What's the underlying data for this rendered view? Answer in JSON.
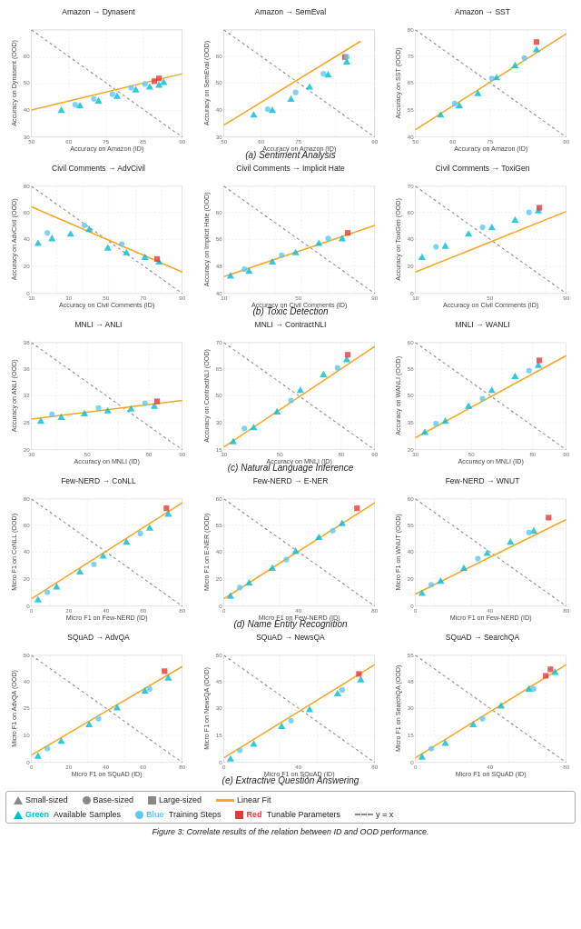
{
  "charts": {
    "row1": {
      "label": "(a) Sentiment Analysis",
      "plots": [
        {
          "title": "Amazon → Dynasent",
          "xLabel": "Accuracy on Amazon (ID)",
          "yLabel": "Accuracy on Dynasent (OOD)",
          "xRange": [
            50,
            90
          ],
          "yRange": [
            30,
            60
          ]
        },
        {
          "title": "Amazon → SemEval",
          "xLabel": "Accuracy on Amazon (ID)",
          "yLabel": "Accuracy on SemEval (OOD)",
          "xRange": [
            50,
            90
          ],
          "yRange": [
            30,
            60
          ]
        },
        {
          "title": "Amazon → SST",
          "xLabel": "Accuracy on Amazon (ID)",
          "yLabel": "Accuracy on SST (OOD)",
          "xRange": [
            50,
            90
          ],
          "yRange": [
            40,
            80
          ]
        }
      ]
    },
    "row2": {
      "label": "(b) Toxic Detection",
      "plots": [
        {
          "title": "Civil Comments → AdvCivil",
          "xLabel": "Accuracy on Civil Comments (ID)",
          "yLabel": "Accuracy on AdvCivil (OOD)",
          "xRange": [
            10,
            90
          ],
          "yRange": [
            0,
            80
          ]
        },
        {
          "title": "Civil Comments → Implicit Hate",
          "xLabel": "Accuracy on Civil Comments (ID)",
          "yLabel": "Accuracy on Implicit Hate (OOD)",
          "xRange": [
            10,
            90
          ],
          "yRange": [
            40,
            60
          ]
        },
        {
          "title": "Civil Comments → ToxiGen",
          "xLabel": "Accuracy on Civil Comments (ID)",
          "yLabel": "Accuracy on ToxiGen (OOD)",
          "xRange": [
            10,
            90
          ],
          "yRange": [
            0,
            70
          ]
        }
      ]
    },
    "row3": {
      "label": "(c) Natural Language Inference",
      "plots": [
        {
          "title": "MNLI → ANLI",
          "xLabel": "Accuracy on MNLI (ID)",
          "yLabel": "Accuracy on ANLI (OOD)",
          "xRange": [
            30,
            90
          ],
          "yRange": [
            20,
            38
          ]
        },
        {
          "title": "MNLI → ContractNLI",
          "xLabel": "Accuracy on MNLI (ID)",
          "yLabel": "Accuracy on ContractNLI (OOD)",
          "xRange": [
            30,
            90
          ],
          "yRange": [
            15,
            70
          ]
        },
        {
          "title": "MNLI → WANLI",
          "xLabel": "Accuracy on MNLI (ID)",
          "yLabel": "Accuracy on WANLI (OOD)",
          "xRange": [
            30,
            90
          ],
          "yRange": [
            20,
            60
          ]
        }
      ]
    },
    "row4": {
      "label": "(d) Name Entity Recognition",
      "plots": [
        {
          "title": "Few-NERD → CoNLL",
          "xLabel": "Micro F1 on Few-NERD (ID)",
          "yLabel": "Micro F1 on CoNLL (OOD)",
          "xRange": [
            0,
            80
          ],
          "yRange": [
            0,
            80
          ]
        },
        {
          "title": "Few-NERD → E-NER",
          "xLabel": "Micro F1 on Few-NERD (ID)",
          "yLabel": "Micro F1 on E-NER (OOD)",
          "xRange": [
            0,
            80
          ],
          "yRange": [
            0,
            60
          ]
        },
        {
          "title": "Few-NERD → WNUT",
          "xLabel": "Micro F1 on Few-NERD (ID)",
          "yLabel": "Micro F1 on WNUT (OOD)",
          "xRange": [
            0,
            80
          ],
          "yRange": [
            0,
            60
          ]
        }
      ]
    },
    "row5": {
      "label": "(e) Extractive Question Answering",
      "plots": [
        {
          "title": "SQuAD → AdvQA",
          "xLabel": "Micro F1 on SQuAD (ID)",
          "yLabel": "Micro F1 on AdvQA (OOD)",
          "xRange": [
            0,
            80
          ],
          "yRange": [
            0,
            50
          ]
        },
        {
          "title": "SQuAD → NewsQA",
          "xLabel": "Micro F1 on SQuAD (ID)",
          "yLabel": "Micro F1 on NewsQA (OOD)",
          "xRange": [
            0,
            80
          ],
          "yRange": [
            0,
            50
          ]
        },
        {
          "title": "SQuAD → SearchQA",
          "xLabel": "Micro F1 on SQuAD (ID)",
          "yLabel": "Micro F1 on SearchQA (OOD)",
          "xRange": [
            0,
            80
          ],
          "yRange": [
            0,
            55
          ]
        }
      ]
    }
  },
  "legend": {
    "items": [
      {
        "symbol": "triangle",
        "color": "#888",
        "label": "Small-sized"
      },
      {
        "symbol": "circle",
        "color": "#888",
        "label": "Base-sized"
      },
      {
        "symbol": "square",
        "color": "#888",
        "label": "Large-sized"
      },
      {
        "symbol": "line",
        "color": "#f5a623",
        "label": "Linear Fit"
      },
      {
        "symbol": "triangle",
        "color": "#00bcd4",
        "label": "Green  Available Samples"
      },
      {
        "symbol": "circle",
        "color": "#00bcd4",
        "label": "Blue  Training Steps"
      },
      {
        "symbol": "square",
        "color": "#e53935",
        "label": "Red  Tunable Parameters"
      },
      {
        "symbol": "dash",
        "color": "#888",
        "label": "y = x"
      }
    ]
  },
  "caption": "Figure 3: Correlate results of the relation between ID and OOD performance."
}
